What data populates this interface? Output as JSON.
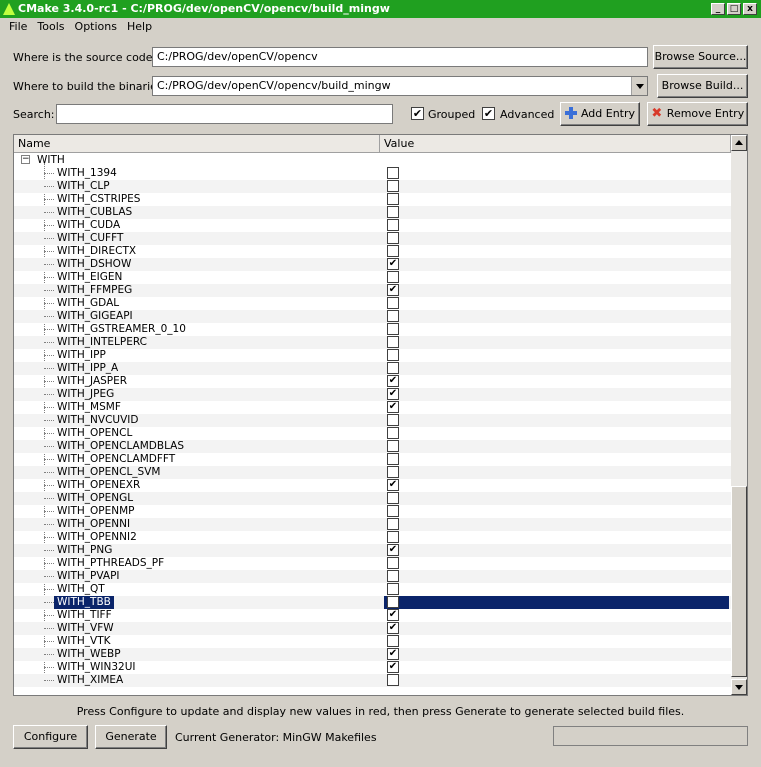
{
  "window": {
    "title": "CMake 3.4.0-rc1 - C:/PROG/dev/openCV/opencv/build_mingw",
    "minimize": "_",
    "maximize": "□",
    "close": "x"
  },
  "menu": [
    "File",
    "Tools",
    "Options",
    "Help"
  ],
  "source": {
    "label": "Where is the source code:",
    "value": "C:/PROG/dev/openCV/opencv",
    "button": "Browse Source..."
  },
  "build": {
    "label": "Where to build the binaries:",
    "value": "C:/PROG/dev/openCV/opencv/build_mingw",
    "button": "Browse Build..."
  },
  "search": {
    "label": "Search:",
    "value": ""
  },
  "options": {
    "grouped": "Grouped",
    "grouped_checked": true,
    "advanced": "Advanced",
    "advanced_checked": true
  },
  "entry_buttons": {
    "add": "Add Entry",
    "remove": "Remove Entry"
  },
  "table": {
    "col_name": "Name",
    "col_value": "Value",
    "group": "WITH",
    "rows": [
      {
        "name": "WITH_1394",
        "checked": false
      },
      {
        "name": "WITH_CLP",
        "checked": false
      },
      {
        "name": "WITH_CSTRIPES",
        "checked": false
      },
      {
        "name": "WITH_CUBLAS",
        "checked": false
      },
      {
        "name": "WITH_CUDA",
        "checked": false
      },
      {
        "name": "WITH_CUFFT",
        "checked": false
      },
      {
        "name": "WITH_DIRECTX",
        "checked": false
      },
      {
        "name": "WITH_DSHOW",
        "checked": true
      },
      {
        "name": "WITH_EIGEN",
        "checked": false
      },
      {
        "name": "WITH_FFMPEG",
        "checked": true
      },
      {
        "name": "WITH_GDAL",
        "checked": false
      },
      {
        "name": "WITH_GIGEAPI",
        "checked": false
      },
      {
        "name": "WITH_GSTREAMER_0_10",
        "checked": false
      },
      {
        "name": "WITH_INTELPERC",
        "checked": false
      },
      {
        "name": "WITH_IPP",
        "checked": false
      },
      {
        "name": "WITH_IPP_A",
        "checked": false
      },
      {
        "name": "WITH_JASPER",
        "checked": true
      },
      {
        "name": "WITH_JPEG",
        "checked": true
      },
      {
        "name": "WITH_MSMF",
        "checked": true
      },
      {
        "name": "WITH_NVCUVID",
        "checked": false
      },
      {
        "name": "WITH_OPENCL",
        "checked": false
      },
      {
        "name": "WITH_OPENCLAMDBLAS",
        "checked": false
      },
      {
        "name": "WITH_OPENCLAMDFFT",
        "checked": false
      },
      {
        "name": "WITH_OPENCL_SVM",
        "checked": false
      },
      {
        "name": "WITH_OPENEXR",
        "checked": true
      },
      {
        "name": "WITH_OPENGL",
        "checked": false
      },
      {
        "name": "WITH_OPENMP",
        "checked": false
      },
      {
        "name": "WITH_OPENNI",
        "checked": false
      },
      {
        "name": "WITH_OPENNI2",
        "checked": false
      },
      {
        "name": "WITH_PNG",
        "checked": true
      },
      {
        "name": "WITH_PTHREADS_PF",
        "checked": false
      },
      {
        "name": "WITH_PVAPI",
        "checked": false
      },
      {
        "name": "WITH_QT",
        "checked": false
      },
      {
        "name": "WITH_TBB",
        "checked": false,
        "selected": true
      },
      {
        "name": "WITH_TIFF",
        "checked": true
      },
      {
        "name": "WITH_VFW",
        "checked": true
      },
      {
        "name": "WITH_VTK",
        "checked": false
      },
      {
        "name": "WITH_WEBP",
        "checked": true
      },
      {
        "name": "WITH_WIN32UI",
        "checked": true
      },
      {
        "name": "WITH_XIMEA",
        "checked": false
      }
    ]
  },
  "status": "Press Configure to update and display new values in red, then press Generate to generate selected build files.",
  "bottom": {
    "configure": "Configure",
    "generate": "Generate",
    "generator": "Current Generator: MinGW Makefiles"
  },
  "checkmark": "✔"
}
